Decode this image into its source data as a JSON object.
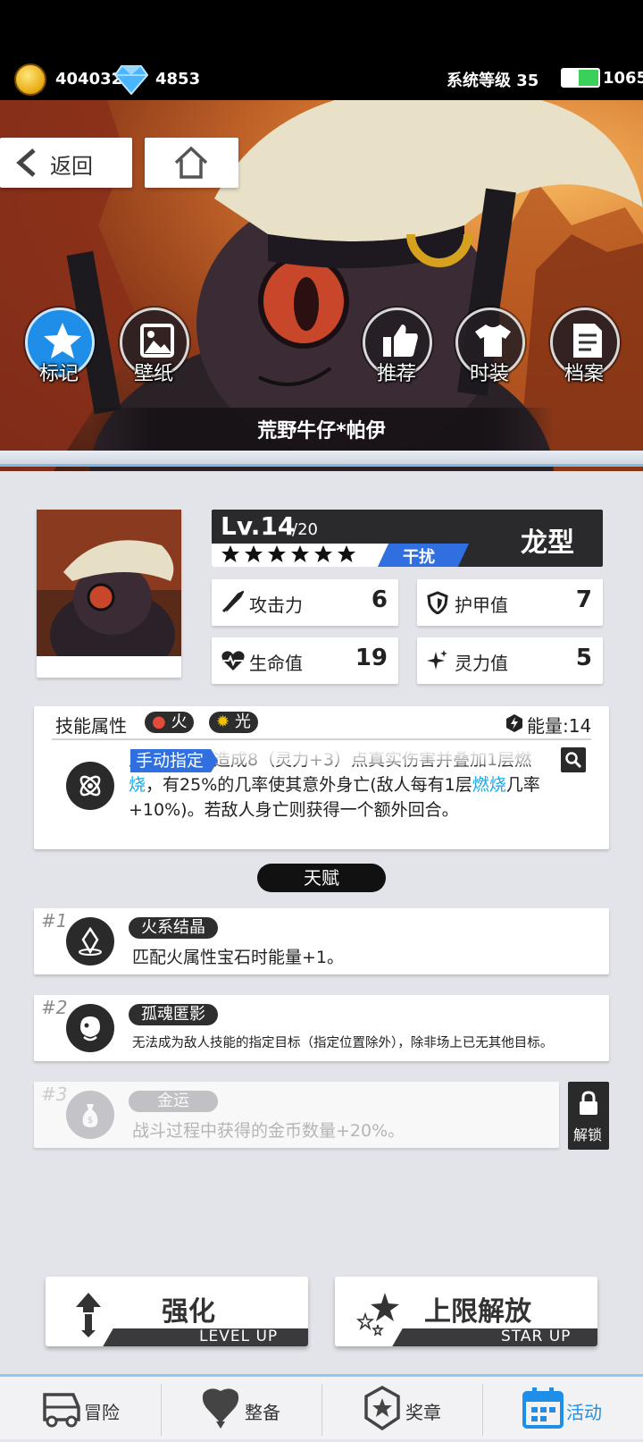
{
  "status": {
    "coins": "404032",
    "gems": "4853",
    "system_level": "系统等级 35",
    "energy": "1065"
  },
  "top_buttons": {
    "back_label": "返回"
  },
  "hero_buttons": [
    {
      "label": "标记",
      "icon": "star-icon",
      "active": true
    },
    {
      "label": "壁纸",
      "icon": "image-icon"
    },
    {
      "label": "推荐",
      "icon": "thumbs-up-icon"
    },
    {
      "label": "时装",
      "icon": "shirt-icon"
    },
    {
      "label": "档案",
      "icon": "file-icon"
    }
  ],
  "character": {
    "name": "荒野牛仔*帕伊",
    "level": "Lv.14",
    "max_level": "/20",
    "stars": 6,
    "role": "干扰",
    "type": "龙型"
  },
  "stats": {
    "attack": {
      "label": "攻击力",
      "value": "6"
    },
    "armor": {
      "label": "护甲值",
      "value": "7"
    },
    "hp": {
      "label": "生命值",
      "value": "19"
    },
    "spirit": {
      "label": "灵力值",
      "value": "5"
    }
  },
  "skill": {
    "header": "技能属性",
    "elements": [
      {
        "label": "火",
        "color": "#e34c3a"
      },
      {
        "label": "光",
        "color": "#f2c200"
      }
    ],
    "energy": "能量:14",
    "tag": "手动指定",
    "desc_line1": "对一名敌人造成8（灵力+3）点真实伤害并叠加1层燃",
    "desc_line2_a": "烧",
    "desc_line2_b": "，有25%的几率使其意外身亡(敌人每有1层",
    "desc_line2_c": "燃烧",
    "desc_line2_d": "几率",
    "desc_line3": "+10%)。若敌人身亡则获得一个额外回合。"
  },
  "talent_header": "天赋",
  "talents": [
    {
      "num": "#1",
      "name": "火系结晶",
      "desc": "匹配火属性宝石时能量+1。",
      "locked": false
    },
    {
      "num": "#2",
      "name": "孤魂匿影",
      "desc": "无法成为敌人技能的指定目标（指定位置除外），除非场上已无其他目标。",
      "locked": false
    },
    {
      "num": "#3",
      "name": "金运",
      "desc": "战斗过程中获得的金币数量+20%。",
      "locked": true
    }
  ],
  "unlock_label": "解锁",
  "actions": {
    "level_up": {
      "label": "强化",
      "sub": "LEVEL UP"
    },
    "star_up": {
      "label": "上限解放",
      "sub": "STAR UP"
    }
  },
  "nav": [
    {
      "label": "冒险",
      "icon": "truck-icon"
    },
    {
      "label": "整备",
      "icon": "heart-shield-icon"
    },
    {
      "label": "奖章",
      "icon": "medal-icon"
    },
    {
      "label": "活动",
      "icon": "calendar-icon",
      "active": true
    }
  ],
  "colors": {
    "accent_blue": "#1e8ee8",
    "dark": "#2a2a2a",
    "link_blue": "#1aa8e6"
  }
}
